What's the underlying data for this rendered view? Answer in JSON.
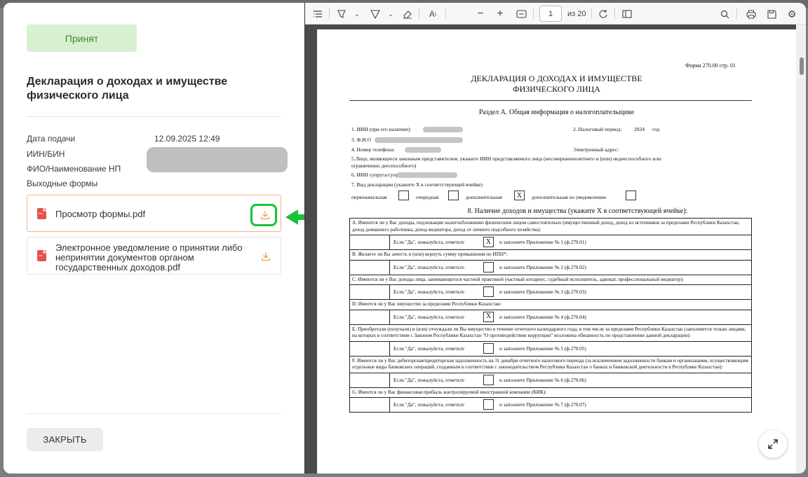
{
  "status": {
    "label": "Принят",
    "color": "#3b8a2c"
  },
  "left": {
    "title": "Декларация о доходах и имуществе физического лица",
    "fields": {
      "submit_date_label": "Дата подачи",
      "submit_date_value": "12.09.2025 12:49",
      "iin_label": "ИИН/БИН",
      "fio_label": "ФИО/Наименование НП",
      "output_forms_label": "Выходные формы"
    },
    "files": [
      {
        "name": "Просмотр формы.pdf",
        "icon": "pdf-icon"
      },
      {
        "name": "Электронное уведомление о принятии либо непринятии документов органом государственных доходов.pdf",
        "icon": "pdf-icon"
      }
    ],
    "close_label": "ЗАКРЫТЬ"
  },
  "toolbar": {
    "page_current": "1",
    "page_total_label": "из 20",
    "icons": [
      "sidebar-toggle-icon",
      "highlight-icon",
      "draw-icon",
      "eraser-icon",
      "text-icon",
      "zoom-out-icon",
      "zoom-in-icon",
      "fit-page-icon",
      "rotate-icon",
      "two-page-icon",
      "search-icon",
      "print-icon",
      "save-icon",
      "settings-icon"
    ]
  },
  "document": {
    "form_number": "Форма 270.00 стр. 01",
    "title_line1": "ДЕКЛАРАЦИЯ О ДОХОДАХ И ИМУЩЕСТВЕ",
    "title_line2": "ФИЗИЧЕСКОГО ЛИЦА",
    "section_a": "Раздел А. Общая информация о налогоплательщике",
    "f1": "1. ИИН (при его наличии):",
    "f2": "2. Налоговый период:",
    "f2_year": "2024",
    "f2_suffix": "год",
    "f3": "3. Ф.И.О",
    "f4": "4. Номер телефона:",
    "email": "Электронный адрес:",
    "f5": "5.Лицо, являющееся законным представителем, укажите ИИН представляемого лица (несовершеннолетнего и (или) недееспособного или",
    "f5b": "ограниченно дееспособного)",
    "f6": "6. ИИН супруга/супруги",
    "f7": "7. Вид декларации (укажите Х в соответствующей ячейке)",
    "types": [
      "первоначальная",
      "очередная",
      "дополнительная",
      "дополнительная по уведомлению"
    ],
    "types_marked": "X",
    "heading8": "8. Наличие доходов и имущества (укажите Х в соответствующей ячейке):",
    "yes_label": "Если \"Да\", пожалуйста, отметьте",
    "questions": [
      {
        "q": "А. Имеются ли у Вас доходы, подлежащие налогообложению физическим лицом самостоятельно (имущественный доход, доход из источников за пределами Республики Казахстан, доход домашнего работника, доход медиатора, доход от личного подсобного хозяйства):",
        "mark": "X",
        "annex": "и заполните Приложение № 1 (ф.270.01)"
      },
      {
        "q": "В. Желаете ли Вы зачесть и (или) вернуть сумму превышения по ИПН*:",
        "mark": "",
        "annex": "и заполните Приложение № 2 (ф.270.02)"
      },
      {
        "q": "С. Имеются ли у Вас доходы лица, занимающегося частной практикой (частный нотариус, судебный исполнитель, адвокат, профессиональный медиатор):",
        "mark": "",
        "annex": "и заполните Приложение № 3 (ф.270.03)"
      },
      {
        "q": "D. Имеется ли у Вас имущество за пределами Республики Казахстан:",
        "mark": "X",
        "annex": "и заполните Приложение № 4 (ф.270.04)"
      },
      {
        "q": "Е. Приобретали (получали) и (или) отчуждали ли Вы имущество в течение отчетного календарного года, в том числе за пределами Республики Казахстан (заполняется только лицами, на которых в соответствии с Законом Республики Казахстан \"О противодействии коррупции\" возложена обязанность по представлению данной декларации):",
        "mark": "",
        "annex": "и заполните Приложение № 5 (ф.270.05)"
      },
      {
        "q": "F. Имеются ли у Вас дебиторская/кредиторская задолженность на 31 декабря отчетного налогового периода (за исключением задолженности банкам и организациям, осуществляющим отдельные виды банковских операций, созданным в соответствии с законодательством Республики Казахстан о банках и банковской деятельности в Республике Казахстан):",
        "mark": "",
        "annex": "и заполните Приложение № 6 (ф.270.06)"
      },
      {
        "q": "G. Имеется ли у Вас финансовая прибыль контролируемой иностранной компании (КИК):",
        "mark": "",
        "annex": "и заполните Приложение № 7 (ф.270.07)"
      }
    ]
  },
  "colors": {
    "accent_green": "#1cc13b",
    "download_orange": "#f0a050",
    "pdf_red": "#e5534b"
  }
}
